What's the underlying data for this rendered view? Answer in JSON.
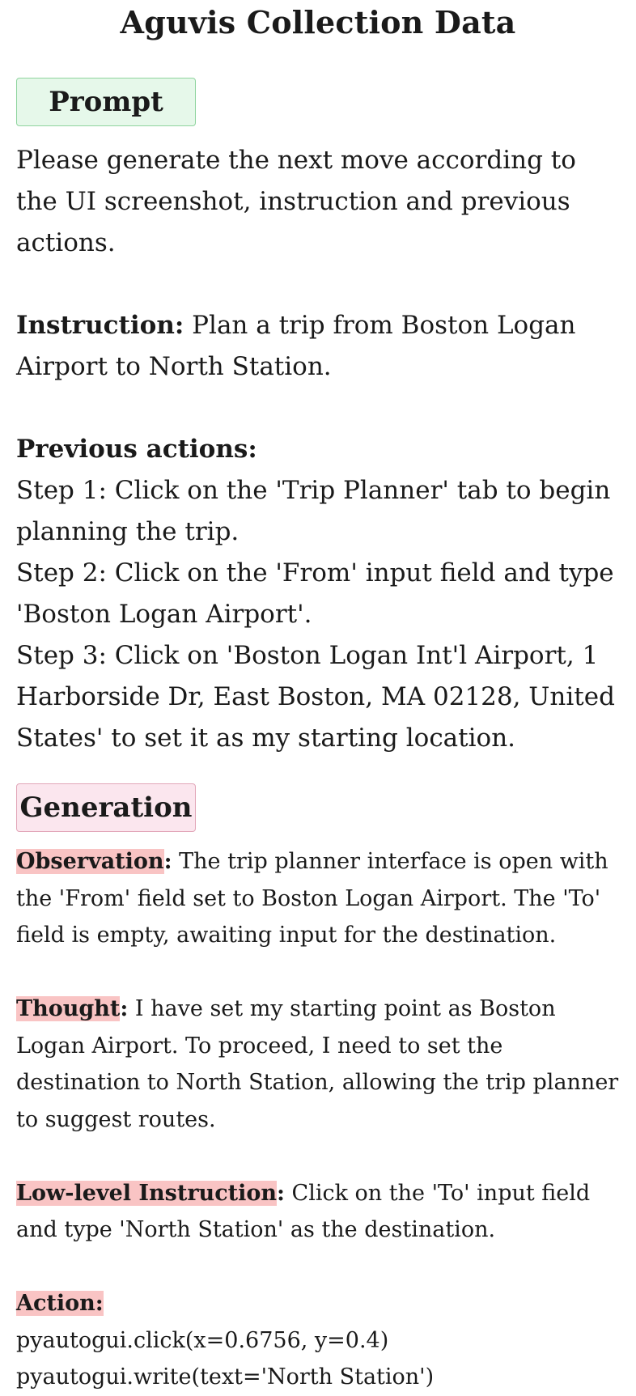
{
  "title": "Aguvis Collection Data",
  "prompt": {
    "header": "Prompt",
    "intro": "Please generate the next move according to the UI screenshot, instruction and previous actions.",
    "instruction_label": "Instruction:",
    "instruction_text": " Plan a trip from Boston Logan Airport to North Station.",
    "previous_actions_label": "Previous actions:",
    "steps": [
      "Step 1: Click on the 'Trip Planner' tab to begin planning the trip.",
      "Step 2: Click on the 'From' input field and type 'Boston Logan Airport'.",
      "Step 3: Click on 'Boston Logan Int'l Airport, 1 Harborside Dr, East Boston, MA 02128, United States' to set it as my starting location."
    ]
  },
  "generation": {
    "header": "Generation",
    "observation_label": "Observation",
    "observation_text": "  The trip planner interface is open with the 'From' field set to Boston Logan Airport. The 'To' field is empty, awaiting input for the destination.",
    "thought_label": "Thought",
    "thought_text": " I have set my starting point as Boston Logan Airport. To proceed, I need to set the destination to North Station, allowing the trip planner to suggest routes.",
    "low_level_label": "Low-level Instruction",
    "low_level_text": " Click on the 'To' input field and type 'North Station' as the destination.",
    "action_label": "Action:",
    "action_lines": [
      "pyautogui.click(x=0.6756, y=0.4)",
      "pyautogui.write(text='North Station')"
    ]
  }
}
